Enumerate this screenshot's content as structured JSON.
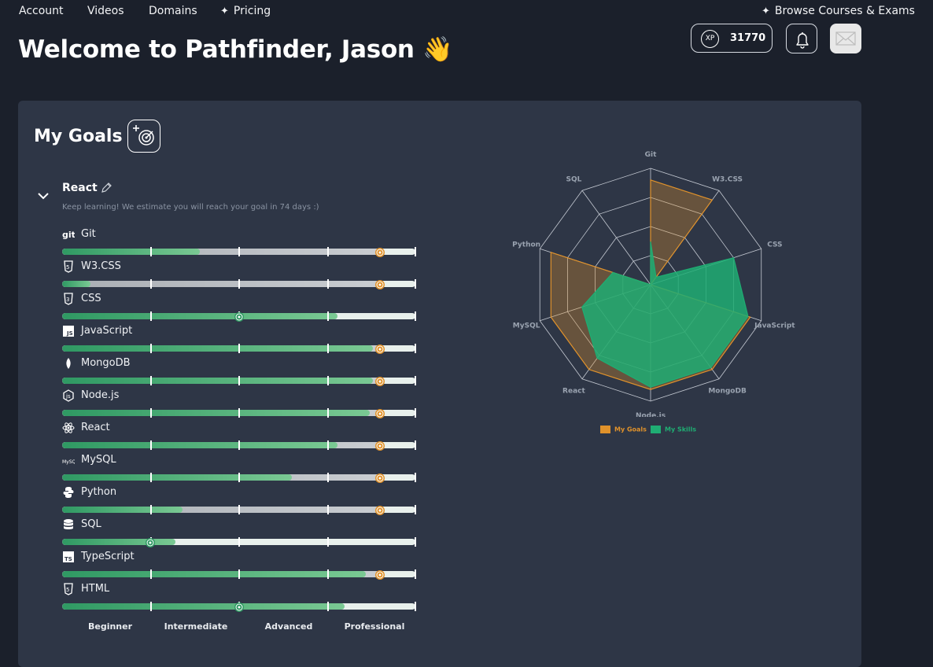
{
  "nav": {
    "account": "Account",
    "videos": "Videos",
    "domains": "Domains",
    "pricing": "Pricing",
    "browse": "Browse Courses & Exams"
  },
  "header": {
    "welcome": "Welcome to Pathfinder, Jason 👋",
    "xp_badge": "XP",
    "xp_value": "31770"
  },
  "goals": {
    "title": "My Goals",
    "goal_name": "React",
    "estimate": "Keep learning! We estimate you will reach your goal in 74 days :)",
    "levels": [
      "Beginner",
      "Intermediate",
      "Advanced",
      "Professional"
    ],
    "skills": [
      {
        "name": "Git",
        "icon": "git-icon",
        "progress": 0.39,
        "goal": 0.9,
        "goal_met": false
      },
      {
        "name": "W3.CSS",
        "icon": "html5-icon",
        "progress": 0.08,
        "goal": 0.9,
        "goal_met": false
      },
      {
        "name": "CSS",
        "icon": "css3-icon",
        "progress": 0.78,
        "goal": 0.5,
        "goal_met": true
      },
      {
        "name": "JavaScript",
        "icon": "javascript-icon",
        "progress": 0.88,
        "goal": 0.9,
        "goal_met": false
      },
      {
        "name": "MongoDB",
        "icon": "mongodb-leaf-icon",
        "progress": 0.88,
        "goal": 0.9,
        "goal_met": false
      },
      {
        "name": "Node.js",
        "icon": "nodejs-icon",
        "progress": 0.87,
        "goal": 0.9,
        "goal_met": false
      },
      {
        "name": "React",
        "icon": "react-atom-icon",
        "progress": 0.78,
        "goal": 0.9,
        "goal_met": false
      },
      {
        "name": "MySQL",
        "icon": "mysql-icon",
        "progress": 0.65,
        "goal": 0.9,
        "goal_met": false
      },
      {
        "name": "Python",
        "icon": "python-icon",
        "progress": 0.34,
        "goal": 0.9,
        "goal_met": false
      },
      {
        "name": "SQL",
        "icon": "database-icon",
        "progress": 0.32,
        "goal": 0.25,
        "goal_met": true
      },
      {
        "name": "TypeScript",
        "icon": "typescript-icon",
        "progress": 0.86,
        "goal": 0.9,
        "goal_met": false
      },
      {
        "name": "HTML",
        "icon": "html5-icon",
        "progress": 0.8,
        "goal": 0.5,
        "goal_met": true
      }
    ]
  },
  "radar": {
    "axes": [
      "Git",
      "W3.CSS",
      "CSS",
      "JavaScript",
      "MongoDB",
      "Node.js",
      "React",
      "MySQL",
      "Python",
      "SQL"
    ],
    "goals_values": [
      0.9,
      0.9,
      0.0,
      0.9,
      0.9,
      0.9,
      0.9,
      0.9,
      0.9,
      0.0
    ],
    "skills_values": [
      0.37,
      0.08,
      0.75,
      0.88,
      0.88,
      0.88,
      0.78,
      0.62,
      0.34,
      0.0
    ],
    "legend_goals": "My Goals",
    "legend_skills": "My Skills",
    "colors": {
      "goals": "#e0922b",
      "skills": "#1fad73"
    }
  },
  "colors": {
    "background": "#1b202b",
    "card": "#2e3646",
    "progress": "#2f9963",
    "goal_marker": "#e0922b"
  }
}
